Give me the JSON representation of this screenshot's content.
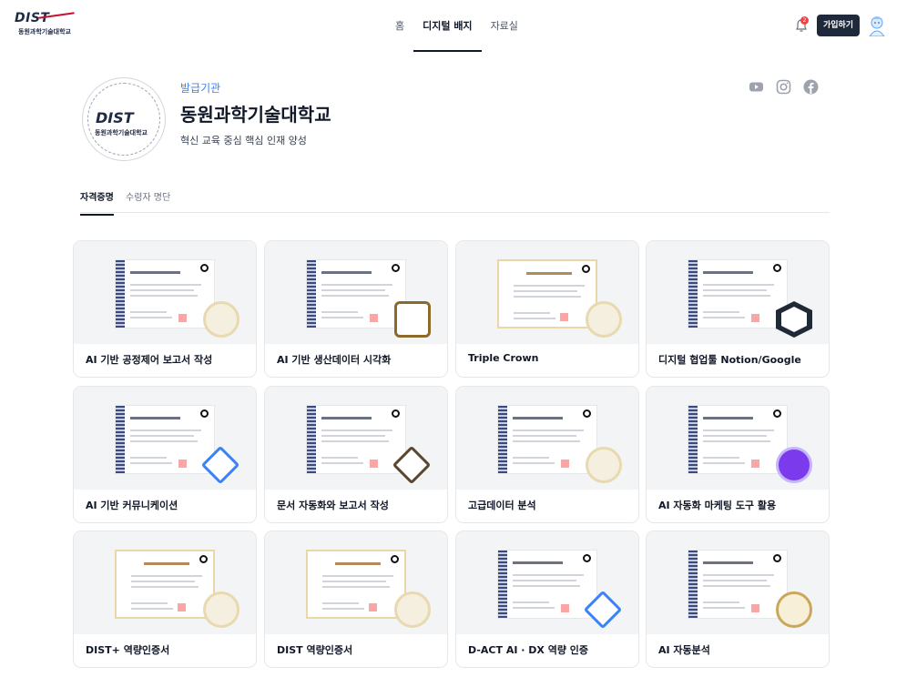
{
  "header": {
    "logo_mark": "DIST",
    "logo_subtitle": "동원과학기술대학교",
    "nav": [
      "홈",
      "디지털 배지",
      "자료실"
    ],
    "active_nav": "디지털 배지",
    "notification_count": "2",
    "join_label": "가입하기"
  },
  "issuer": {
    "label": "발급기관",
    "name": "동원과학기술대학교",
    "description": "혁신 교육 중심 핵심 인재 양성",
    "seal_mark": "DIST",
    "seal_subtitle": "동원과학기술대학교",
    "social": [
      "youtube-icon",
      "instagram-icon",
      "facebook-icon"
    ]
  },
  "tabs": [
    "자격증명",
    "수령자 명단"
  ],
  "active_tab": "자격증명",
  "cards": [
    {
      "title": "AI 기반 공정제어 보고서 작성",
      "badge": "round"
    },
    {
      "title": "AI 기반 생산데이터 시각화",
      "badge": "octa"
    },
    {
      "title": "Triple Crown",
      "badge": "round"
    },
    {
      "title": "디지털 협업툴 Notion/Google",
      "badge": "hex"
    },
    {
      "title": "AI 기반 커뮤니케이션",
      "badge": "diamond"
    },
    {
      "title": "문서 자동화와 보고서 작성",
      "badge": "diamond-dark"
    },
    {
      "title": "고급데이터 분석",
      "badge": "round"
    },
    {
      "title": "AI 자동화 마케팅 도구 활용",
      "badge": "purple"
    },
    {
      "title": "DIST+ 역량인증서",
      "badge": "round"
    },
    {
      "title": "DIST 역량인증서",
      "badge": "round"
    },
    {
      "title": "D-ACT AI · DX 역량 인증",
      "badge": "diamond"
    },
    {
      "title": "AI 자동분석",
      "badge": "gold-medal"
    }
  ],
  "colors": {
    "accent": "#3b82f6",
    "brand_red": "#c8102e",
    "button_dark": "#1e293b"
  }
}
